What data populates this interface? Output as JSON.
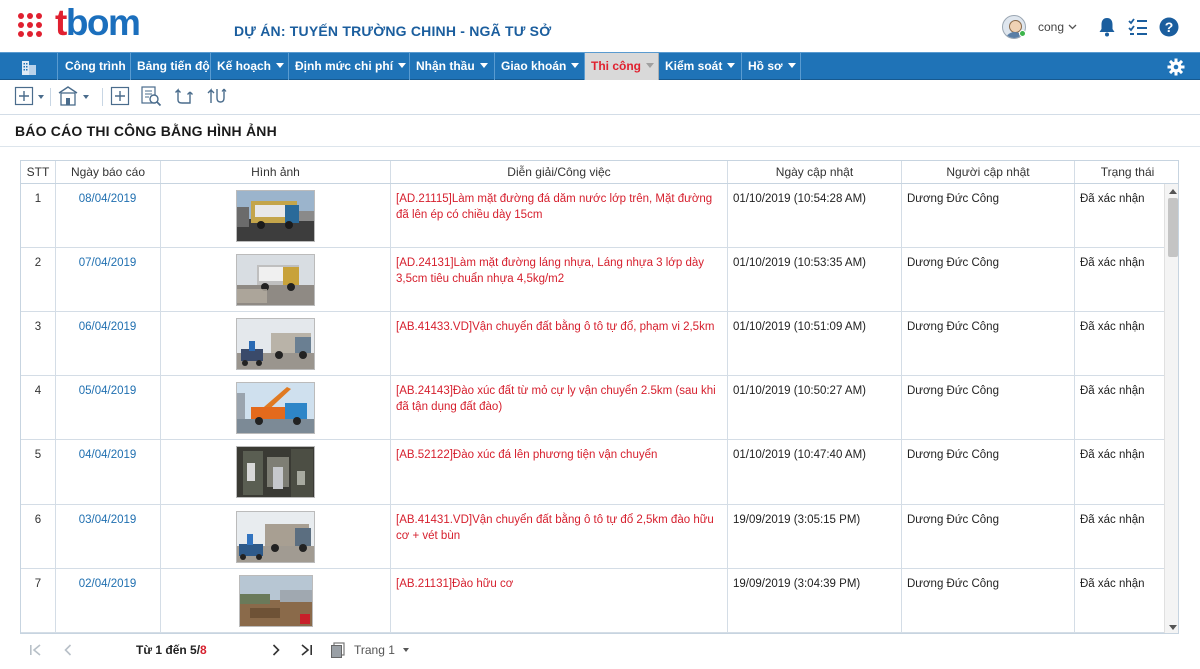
{
  "header": {
    "logo_text": "bom",
    "logo_prefix": "t",
    "project_title": "DỰ ÁN: TUYẾN TRƯỜNG CHINH - NGÃ TƯ SỞ",
    "username": "cong",
    "user_caret": "⌄"
  },
  "nav": {
    "items": [
      {
        "label": "Công trình"
      },
      {
        "label": "Bảng tiến độ"
      },
      {
        "label": "Kế hoạch"
      },
      {
        "label": "Định mức chi phí"
      },
      {
        "label": "Nhận thầu"
      },
      {
        "label": "Giao khoán"
      },
      {
        "label": "Thi công"
      },
      {
        "label": "Kiểm soát"
      },
      {
        "label": "Hồ sơ"
      }
    ],
    "active": "Thi công"
  },
  "panel": {
    "title": "BÁO CÁO THI CÔNG BẰNG HÌNH ẢNH"
  },
  "table": {
    "columns": [
      "STT",
      "Ngày báo cáo",
      "Hình ảnh",
      "Diễn giải/Công việc",
      "Ngày cập nhật",
      "Người cập nhật",
      "Trạng thái"
    ],
    "rows": [
      {
        "stt": "1",
        "date": "08/04/2019",
        "image": "road-paving-photo",
        "desc": "[AD.21115]Làm mặt đường đá dăm nước lớp trên, Mặt đường đã lên ép có chiều dày 15cm",
        "updated": "01/10/2019 (10:54:28 AM)",
        "user": "Dương Đức Công",
        "status": "Đã xác nhận"
      },
      {
        "stt": "2",
        "date": "07/04/2019",
        "image": "asphalt-truck-photo",
        "desc": "[AD.24131]Làm mặt đường láng nhựa, Láng nhựa 3 lớp dày 3,5cm tiêu chuẩn nhựa 4,5kg/m2",
        "updated": "01/10/2019 (10:53:35 AM)",
        "user": "Dương Đức Công",
        "status": "Đã xác nhận"
      },
      {
        "stt": "3",
        "date": "06/04/2019",
        "image": "dump-truck-photo",
        "desc": "[AB.41433.VD]Vận chuyển đất bằng ô tô tự đổ, phạm vi 2,5km",
        "updated": "01/10/2019 (10:51:09 AM)",
        "user": "Dương Đức Công",
        "status": "Đã xác nhận"
      },
      {
        "stt": "4",
        "date": "05/04/2019",
        "image": "crane-truck-photo",
        "desc": "[AB.24143]Đào xúc đất từ mỏ cự ly vận chuyển 2.5km (sau khi đã tận dụng đất đào)",
        "updated": "01/10/2019 (10:50:27 AM)",
        "user": "Dương Đức Công",
        "status": "Đã xác nhận"
      },
      {
        "stt": "5",
        "date": "04/04/2019",
        "image": "excavation-photo",
        "desc": "[AB.52122]Đào xúc đá lên phương tiện vận chuyển",
        "updated": "01/10/2019 (10:47:40 AM)",
        "user": "Dương Đức Công",
        "status": "Đã xác nhận"
      },
      {
        "stt": "6",
        "date": "03/04/2019",
        "image": "dump-truck-photo-2",
        "desc": "[AB.41431.VD]Vận chuyển đất bằng ô tô tự đổ 2,5km đào hữu cơ + vét bùn",
        "updated": "19/09/2019 (3:05:15 PM)",
        "user": "Dương Đức Công",
        "status": "Đã xác nhận"
      },
      {
        "stt": "7",
        "date": "02/04/2019",
        "image": "organic-dig-photo",
        "desc": "[AB.21131]Đào hữu cơ",
        "updated": "19/09/2019 (3:04:39 PM)",
        "user": "Dương Đức Công",
        "status": "Đã xác nhận"
      },
      {
        "stt": "",
        "date": "",
        "image": "partial-photo",
        "desc": "",
        "updated": "",
        "user": "",
        "status": ""
      }
    ]
  },
  "pager": {
    "range_text": "Từ 1 đến 5/",
    "total": "8",
    "page_label": "Trang 1"
  },
  "colors": {
    "brand_blue": "#1f73b7",
    "accent_red": "#e02030",
    "link_blue": "#1f6fb0",
    "desc_red": "#d6202e"
  }
}
